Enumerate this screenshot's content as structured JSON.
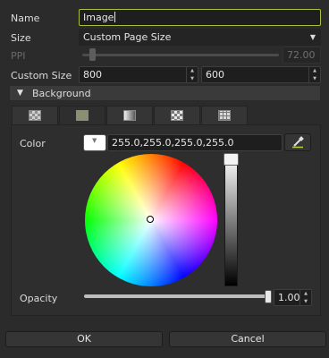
{
  "name": {
    "label": "Name",
    "value": "Image"
  },
  "size": {
    "label": "Size",
    "value": "Custom Page Size"
  },
  "ppi": {
    "label": "PPI",
    "value": "72.00"
  },
  "custom_size": {
    "label": "Custom Size",
    "width": "800",
    "height": "600"
  },
  "background": {
    "label": "Background",
    "tabs": [
      "transparent",
      "solid",
      "gradient",
      "checker",
      "grid"
    ]
  },
  "color": {
    "label": "Color",
    "value": "255.0,255.0,255.0,255.0"
  },
  "opacity": {
    "label": "Opacity",
    "value": "1.00",
    "fraction": 1.0
  },
  "buttons": {
    "ok": "OK",
    "cancel": "Cancel"
  },
  "colors": {
    "accent": "#a8c040",
    "background": "#2b2b2b",
    "field": "#1e1e1e"
  }
}
